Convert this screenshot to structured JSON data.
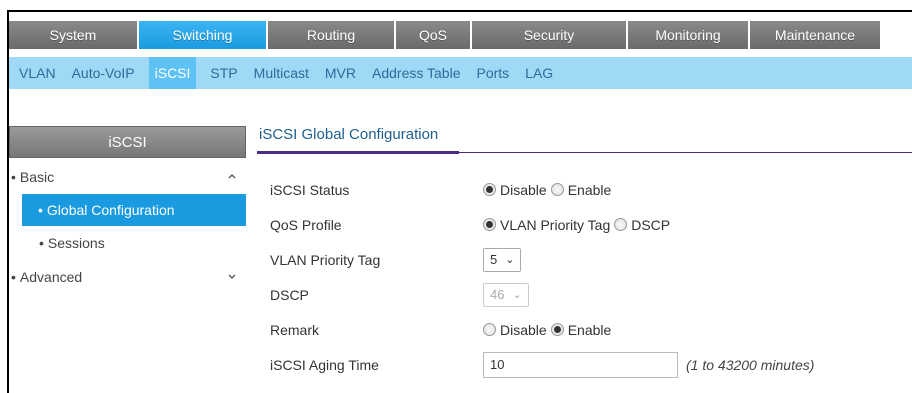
{
  "top_nav": [
    {
      "label": "System",
      "width": 128
    },
    {
      "label": "Switching",
      "active": true
    },
    {
      "label": "Routing"
    },
    {
      "label": "QoS"
    },
    {
      "label": "Security"
    },
    {
      "label": "Monitoring"
    },
    {
      "label": "Maintenance"
    }
  ],
  "sub_nav": [
    "VLAN",
    "Auto-VoIP",
    "iSCSI",
    "STP",
    "Multicast",
    "MVR",
    "Address Table",
    "Ports",
    "LAG"
  ],
  "sub_nav_active": "iSCSI",
  "sidebar": {
    "title": "iSCSI",
    "items": [
      {
        "label": "Basic"
      },
      {
        "label": "Global Configuration"
      },
      {
        "label": "Sessions"
      },
      {
        "label": "Advanced"
      }
    ]
  },
  "main": {
    "section_title": "iSCSI Global Configuration",
    "iscsi_status": {
      "label": "iSCSI Status",
      "options": [
        "Disable",
        "Enable"
      ],
      "selected": "Disable"
    },
    "qos_profile": {
      "label": "QoS Profile",
      "options": [
        "VLAN Priority Tag",
        "DSCP"
      ],
      "selected": "VLAN Priority Tag"
    },
    "vlan_priority_tag": {
      "label": "VLAN Priority Tag",
      "value": "5"
    },
    "dscp": {
      "label": "DSCP",
      "value": "46"
    },
    "remark": {
      "label": "Remark",
      "options": [
        "Disable",
        "Enable"
      ],
      "selected": "Enable"
    },
    "aging_time": {
      "label": "iSCSI Aging Time",
      "value": "10",
      "hint": "(1 to 43200 minutes)"
    }
  },
  "colors": {
    "accent": "#1a9be0",
    "subnav_bg": "#9fd9f6",
    "tab_gray": "#777777",
    "section_underline": "#4a2d87"
  },
  "icons": {
    "dropdown": "chevron-down-icon",
    "collapse": "chevron-up-icon",
    "expand": "chevron-down-icon"
  }
}
